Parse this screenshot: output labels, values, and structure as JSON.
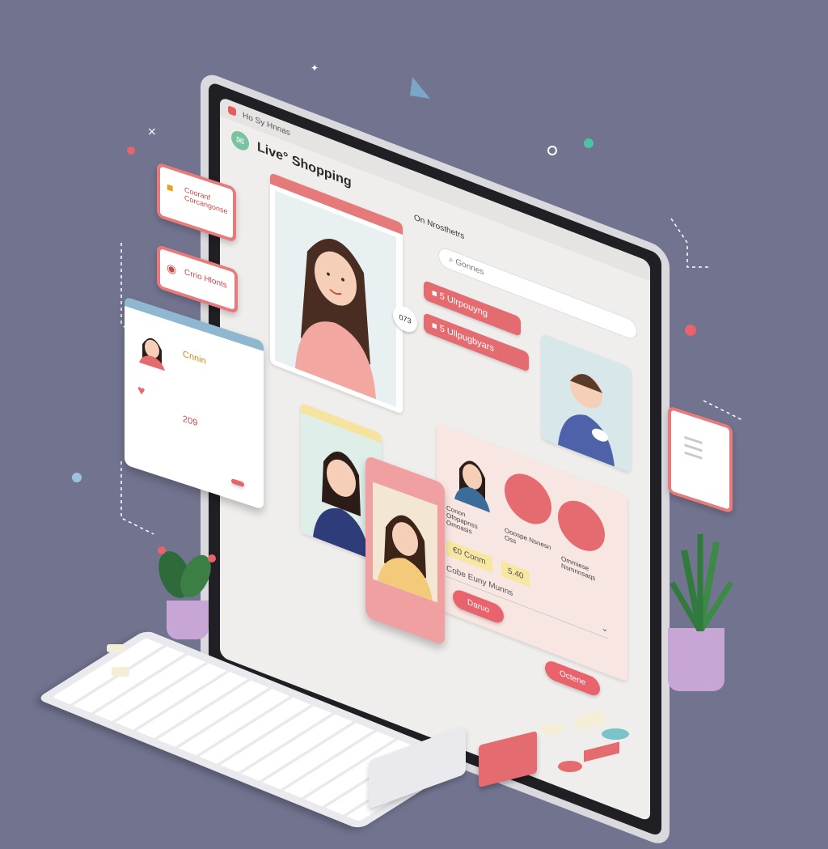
{
  "browser": {
    "tab_label": "Ho Sy Hnnas"
  },
  "app": {
    "title": "Live° Shopping",
    "center_label": "On Nrosthetrs",
    "search_placeholder": "Gonnes"
  },
  "stream_badge": "073",
  "product_pills": [
    {
      "label": "5 Ulrpouyng"
    },
    {
      "label": "5 Ullpugbyars"
    }
  ],
  "product_card": {
    "captions": [
      "Conon Ofopapnss Omoasis",
      "Ooospe Nsnesn Oss",
      "Ommiese Nsmnnsaqs"
    ],
    "price_tag": "€0 Conm",
    "price_value": "5.40",
    "dropdown_label": "Cobe Euny Munns",
    "buy_button": "Daruo",
    "cart_button": "Octene"
  },
  "floating": {
    "bubble_top": "Cooranf Corcangonse",
    "bubble_mid": "Crrio Hlonts",
    "card_name": "Cnnin",
    "card_value": "209"
  },
  "colors": {
    "background": "#72738f",
    "accent": "#e46b6f",
    "screen": "#efeeec"
  },
  "icons": [
    "chat-icon",
    "search-icon",
    "heart-icon",
    "gift-icon",
    "plant-icon"
  ]
}
